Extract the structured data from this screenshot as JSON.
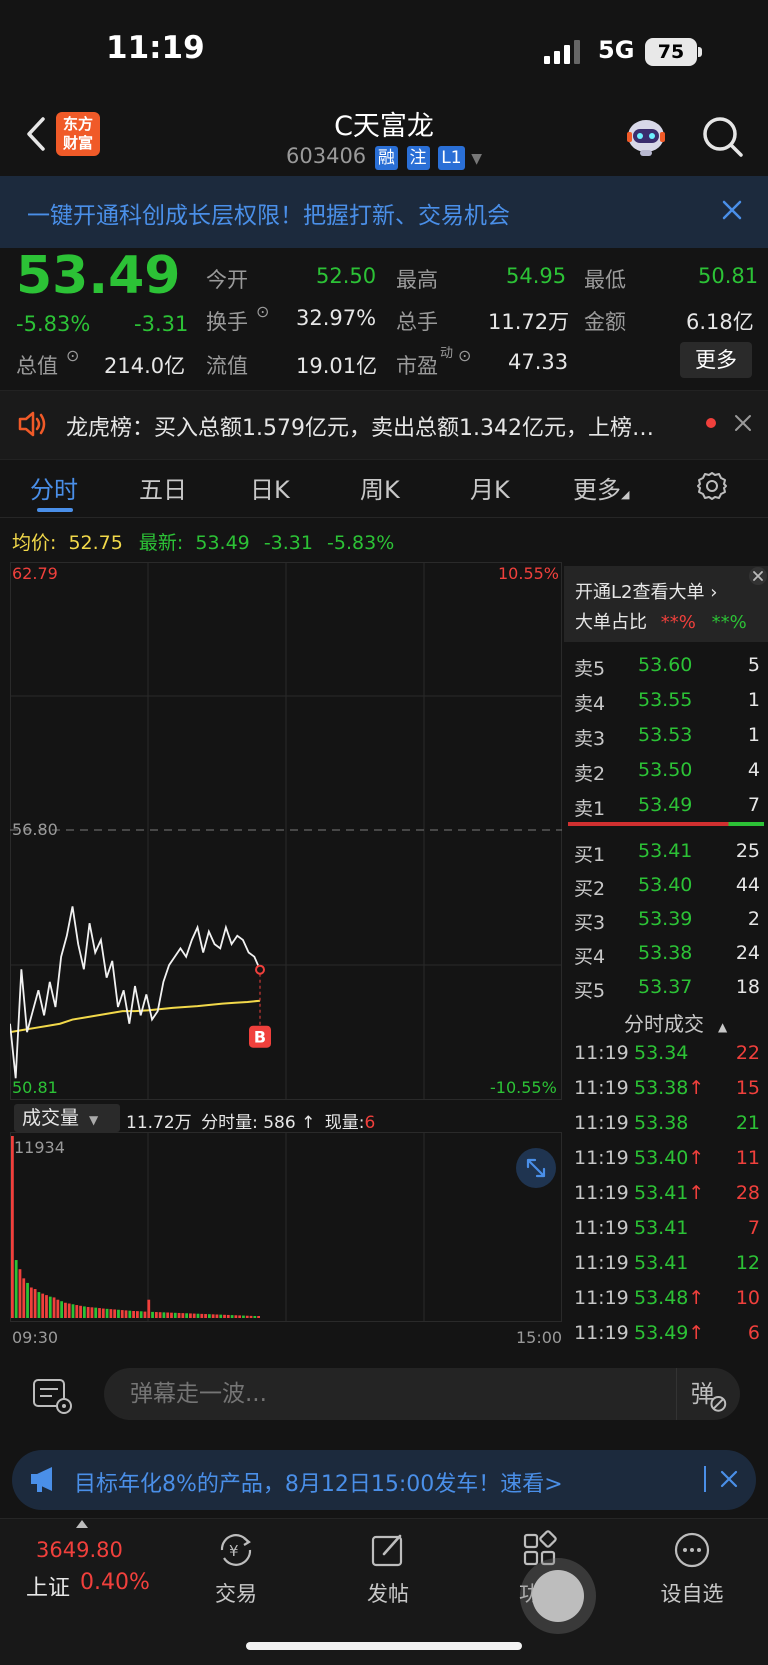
{
  "status_bar": {
    "time": "11:19",
    "network": "5G",
    "battery": "75"
  },
  "header": {
    "logo_line1": "东方",
    "logo_line2": "财富",
    "stock_name": "C天富龙",
    "stock_code": "603406",
    "tags": [
      "融",
      "注",
      "L1"
    ]
  },
  "promo_banner": {
    "text": "一键开通科创成长层权限！把握打新、交易机会"
  },
  "quote": {
    "price": "53.49",
    "change_pct": "-5.83%",
    "change": "-3.31",
    "open_label": "今开",
    "open": "52.50",
    "high_label": "最高",
    "high": "54.95",
    "low_label": "最低",
    "low": "50.81",
    "turnover_label": "换手",
    "turnover": "32.97%",
    "volume_label": "总手",
    "volume": "11.72万",
    "amount_label": "金额",
    "amount": "6.18亿",
    "mktcap_label": "总值",
    "mktcap": "214.0亿",
    "float_label": "流值",
    "float": "19.01亿",
    "pe_label": "市盈",
    "pe_sup": "动",
    "pe": "47.33",
    "more_label": "更多"
  },
  "dragon_tiger": {
    "text": "龙虎榜：买入总额1.579亿元，卖出总额1.342亿元，上榜…"
  },
  "tabs": [
    "分时",
    "五日",
    "日K",
    "周K",
    "月K",
    "更多"
  ],
  "avg_row": {
    "avg_label": "均价:",
    "avg": "52.75",
    "latest_label": "最新:",
    "latest": "53.49",
    "latest_change": "-3.31",
    "latest_pct": "-5.83%"
  },
  "chart_axes": {
    "max_price": "62.79",
    "max_pct": "10.55%",
    "mid_price": "56.80",
    "min_price": "50.81",
    "min_pct": "-10.55%",
    "vol_max": "11934",
    "time_start": "09:30",
    "time_end": "15:00",
    "marker": "B"
  },
  "volume_header": {
    "select_label": "成交量",
    "total": "11.72万",
    "period_label": "分时量:",
    "period_value": "586",
    "arrow": "↑",
    "current_label": "现量:",
    "current_value": "6"
  },
  "chart_data": {
    "type": "line",
    "title": "",
    "xlabel": "",
    "ylabel": "",
    "ylim": [
      50.81,
      62.79
    ],
    "x_range": [
      "09:30",
      "15:00"
    ],
    "series": [
      {
        "name": "",
        "values": [
          52.2,
          50.9,
          53.5,
          52.0,
          52.5,
          53.0,
          52.4,
          53.2,
          52.6,
          53.8,
          54.3,
          55.0,
          54.1,
          53.5,
          54.6,
          53.9,
          54.2,
          53.3,
          53.7,
          52.6,
          53.0,
          52.2,
          53.1,
          52.4,
          52.9,
          52.3,
          52.5,
          53.2,
          53.6,
          53.8,
          54.0,
          53.8,
          54.2,
          54.5,
          53.9,
          54.4,
          54.1,
          54.0,
          54.5,
          54.1,
          54.3,
          54.2,
          53.9,
          53.8,
          53.49
        ]
      },
      {
        "name": "均价",
        "values": [
          52.0,
          52.05,
          52.1,
          52.15,
          52.2,
          52.3,
          52.35,
          52.4,
          52.45,
          52.5,
          52.5,
          52.52,
          52.55,
          52.58,
          52.6,
          52.62,
          52.65,
          52.68,
          52.7,
          52.72,
          52.75
        ]
      }
    ],
    "volume": {
      "ylim": [
        0,
        11934
      ],
      "values": [
        11934,
        3800,
        3200,
        2600,
        2300,
        2000,
        1900,
        1700,
        1600,
        1500,
        1400,
        1350,
        1200,
        1100,
        1000,
        950,
        900,
        850,
        800,
        760,
        720,
        700,
        680,
        650,
        620,
        600,
        580,
        560,
        540,
        520,
        500,
        480,
        460,
        450,
        440,
        420,
        1200,
        400,
        390,
        380,
        370,
        360,
        350,
        340,
        330,
        320,
        310,
        300,
        290,
        280,
        270,
        260,
        250,
        240,
        230,
        220,
        210,
        200,
        190,
        180,
        170,
        160,
        150,
        140,
        130,
        120
      ]
    }
  },
  "order_book": {
    "l2_title": "开通L2查看大单 ›",
    "l2_ratio_label": "大单占比",
    "l2_ratio_buy": "**%",
    "l2_ratio_sell": "**%",
    "asks": [
      {
        "label": "卖5",
        "price": "53.60",
        "vol": "5"
      },
      {
        "label": "卖4",
        "price": "53.55",
        "vol": "1"
      },
      {
        "label": "卖3",
        "price": "53.53",
        "vol": "1"
      },
      {
        "label": "卖2",
        "price": "53.50",
        "vol": "4"
      },
      {
        "label": "卖1",
        "price": "53.49",
        "vol": "7"
      }
    ],
    "bids": [
      {
        "label": "买1",
        "price": "53.41",
        "vol": "25"
      },
      {
        "label": "买2",
        "price": "53.40",
        "vol": "44"
      },
      {
        "label": "买3",
        "price": "53.39",
        "vol": "2"
      },
      {
        "label": "买4",
        "price": "53.38",
        "vol": "24"
      },
      {
        "label": "买5",
        "price": "53.37",
        "vol": "18"
      }
    ],
    "trades_title": "分时成交",
    "trades": [
      {
        "time": "11:19",
        "price": "53.34",
        "up": "",
        "vol": "22",
        "vol_color": "#f0403c"
      },
      {
        "time": "11:19",
        "price": "53.38",
        "up": "↑",
        "vol": "15",
        "vol_color": "#f0403c"
      },
      {
        "time": "11:19",
        "price": "53.38",
        "up": "",
        "vol": "21",
        "vol_color": "#2cc236"
      },
      {
        "time": "11:19",
        "price": "53.40",
        "up": "↑",
        "vol": "11",
        "vol_color": "#f0403c"
      },
      {
        "time": "11:19",
        "price": "53.41",
        "up": "↑",
        "vol": "28",
        "vol_color": "#f0403c"
      },
      {
        "time": "11:19",
        "price": "53.41",
        "up": "",
        "vol": "7",
        "vol_color": "#f0403c"
      },
      {
        "time": "11:19",
        "price": "53.41",
        "up": "",
        "vol": "12",
        "vol_color": "#2cc236"
      },
      {
        "time": "11:19",
        "price": "53.48",
        "up": "↑",
        "vol": "10",
        "vol_color": "#f0403c"
      },
      {
        "time": "11:19",
        "price": "53.49",
        "up": "↑",
        "vol": "6",
        "vol_color": "#f0403c"
      }
    ]
  },
  "comment": {
    "placeholder": "弹幕走一波..."
  },
  "ad_banner": {
    "text": "目标年化8%的产品，8月12日15:00发车！速看>"
  },
  "bottom_nav": {
    "index_value": "3649.80",
    "index_name": "上证",
    "index_change": "0.40%",
    "items": [
      "交易",
      "发帖",
      "功能",
      "设自选"
    ]
  },
  "colors": {
    "up": "#f0403c",
    "down": "#2cc236",
    "accent": "#4a8fe8",
    "avg_line": "#f2d94a"
  }
}
